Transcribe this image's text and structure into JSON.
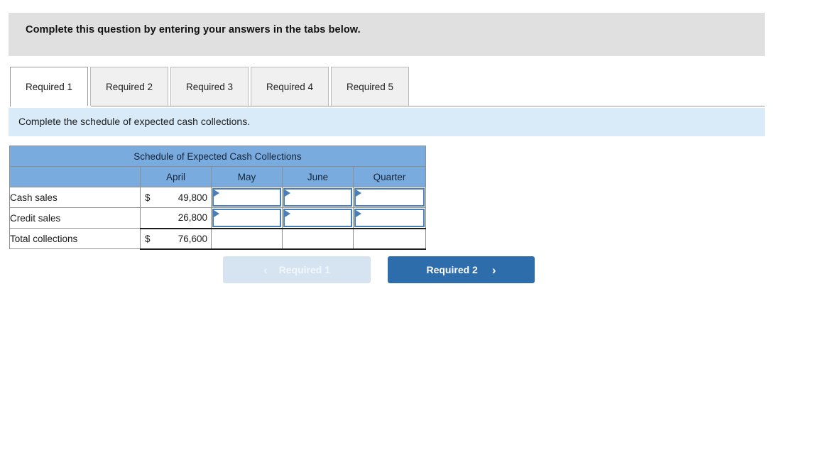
{
  "banner": {
    "text": "Complete this question by entering your answers in the tabs below."
  },
  "tabs": [
    {
      "label": "Required 1",
      "active": true
    },
    {
      "label": "Required 2",
      "active": false
    },
    {
      "label": "Required 3",
      "active": false
    },
    {
      "label": "Required 4",
      "active": false
    },
    {
      "label": "Required 5",
      "active": false
    }
  ],
  "instruction": {
    "text": "Complete the schedule of expected cash collections."
  },
  "table": {
    "title": "Schedule of Expected Cash Collections",
    "columns": [
      "",
      "April",
      "May",
      "June",
      "Quarter"
    ],
    "rows": [
      {
        "label": "Cash sales",
        "april_currency": "$",
        "april_value": "49,800",
        "may": "",
        "june": "",
        "quarter": "",
        "editable": true
      },
      {
        "label": "Credit sales",
        "april_currency": "",
        "april_value": "26,800",
        "may": "",
        "june": "",
        "quarter": "",
        "editable": true
      },
      {
        "label": "Total collections",
        "april_currency": "$",
        "april_value": "76,600",
        "may": "",
        "june": "",
        "quarter": "",
        "editable": false
      }
    ]
  },
  "nav": {
    "prev_label": "Required 1",
    "prev_icon": "chevron-left-icon",
    "prev_glyph": "‹",
    "prev_disabled": true,
    "next_label": "Required 2",
    "next_icon": "chevron-right-icon",
    "next_glyph": "›"
  },
  "colors": {
    "banner_bg": "#e0e0e0",
    "instruction_bg": "#d9ebf9",
    "table_header_bg": "#7aabdf",
    "input_border": "#4a7ebb",
    "btn_next_bg": "#2e6dab",
    "btn_prev_bg": "#d6e4f2"
  }
}
